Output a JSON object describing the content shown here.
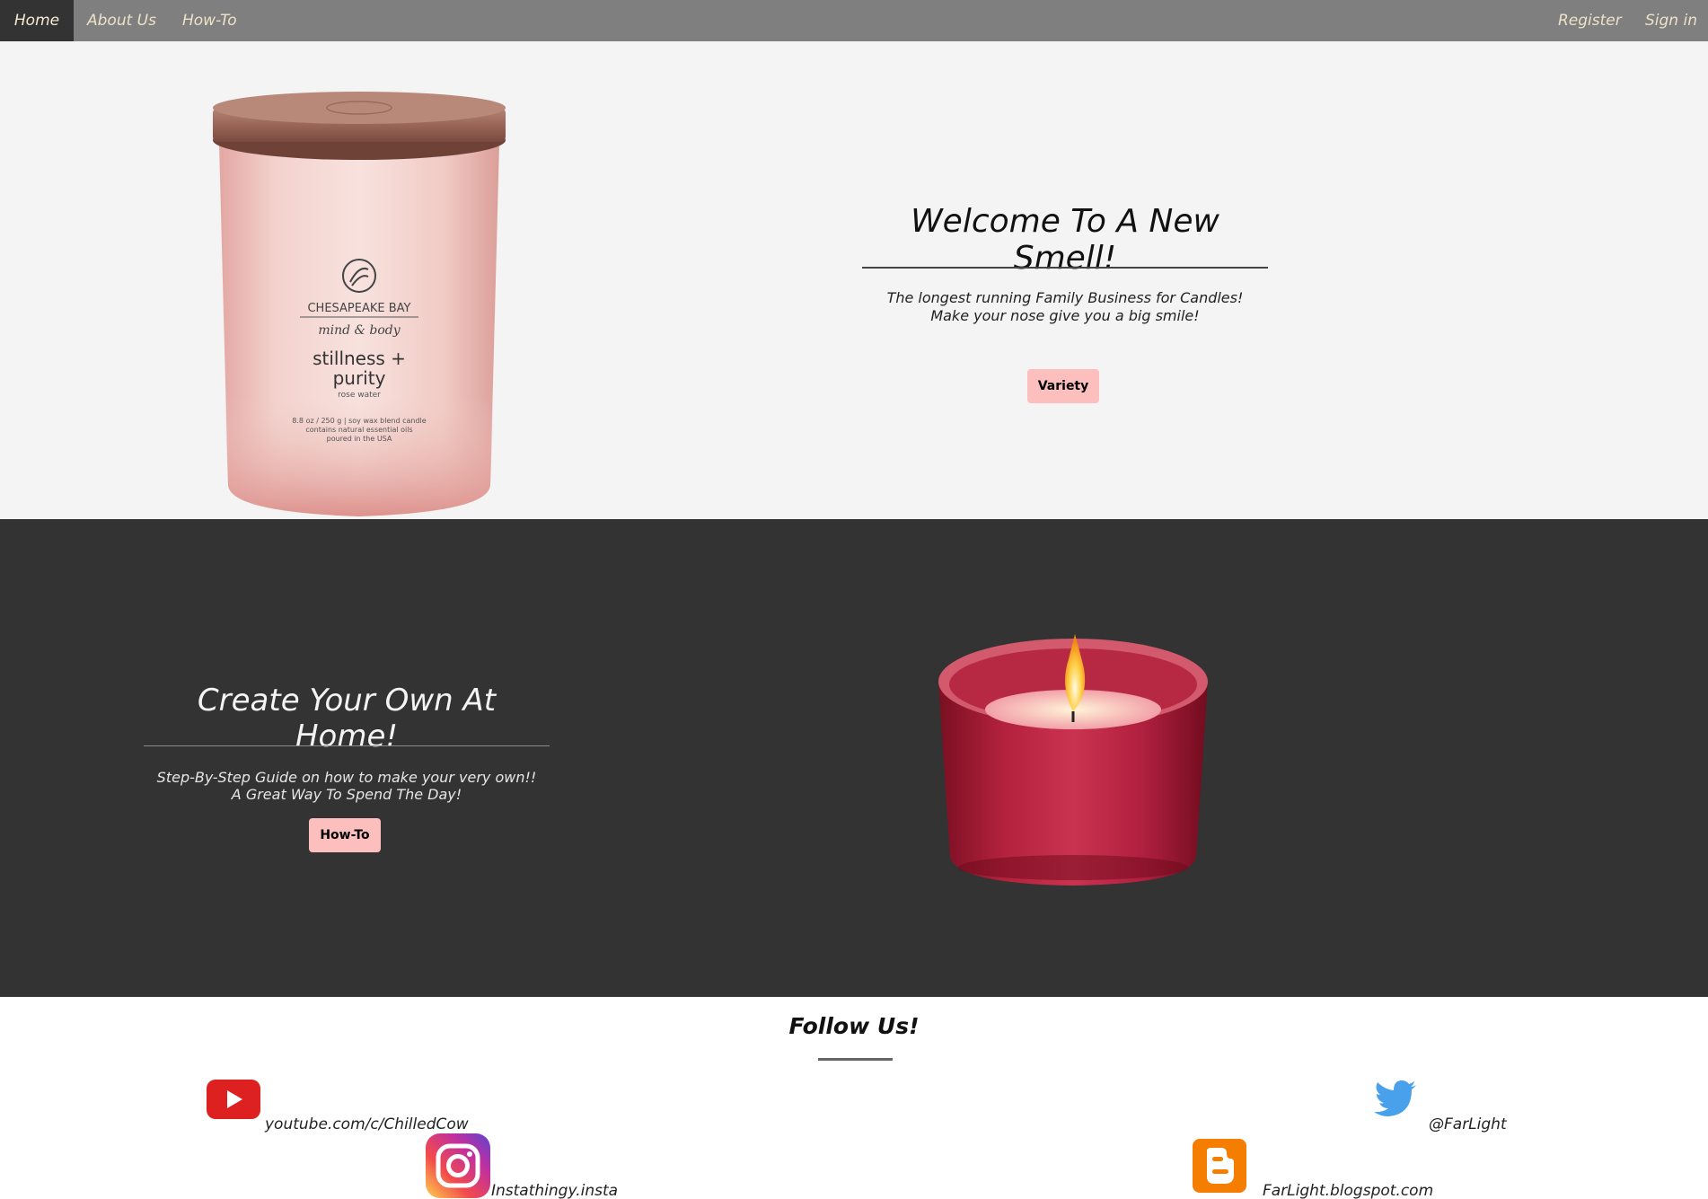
{
  "nav": {
    "home": "Home",
    "about": "About Us",
    "howto": "How-To",
    "register": "Register",
    "signin": "Sign in"
  },
  "hero": {
    "title": "Welcome To A New Smell!",
    "line1": "The longest running Family Business for Candles!",
    "line2": "Make your nose give you a big smile!",
    "button": "Variety",
    "candle_label": {
      "brand": "CHESAPEAKE BAY",
      "sub": "mind & body",
      "name1": "stillness +",
      "name2": "purity",
      "scent": "rose water",
      "info1": "8.8 oz / 250 g | soy wax blend candle",
      "info2": "contains natural essential oils",
      "info3": "poured in the USA"
    }
  },
  "howto_section": {
    "title": "Create Your Own At Home!",
    "line1": "Step-By-Step Guide on how to make your very own!!",
    "line2": "A Great Way To Spend The Day!",
    "button": "How-To"
  },
  "follow": {
    "title": "Follow Us!",
    "youtube": "youtube.com/c/ChilledCow",
    "instagram": "Instathingy.insta",
    "twitter": "@FarLight",
    "blogger": "FarLight.blogspot.com"
  },
  "colors": {
    "nav_bg": "#7f7f7f",
    "nav_active_bg": "#333333",
    "nav_text": "#ece2c8",
    "hero_bg": "#f4f4f4",
    "dark_bg": "#333333",
    "button_bg": "#fcbfbd"
  },
  "icons": [
    "youtube-icon",
    "instagram-icon",
    "twitter-icon",
    "blogger-icon"
  ]
}
